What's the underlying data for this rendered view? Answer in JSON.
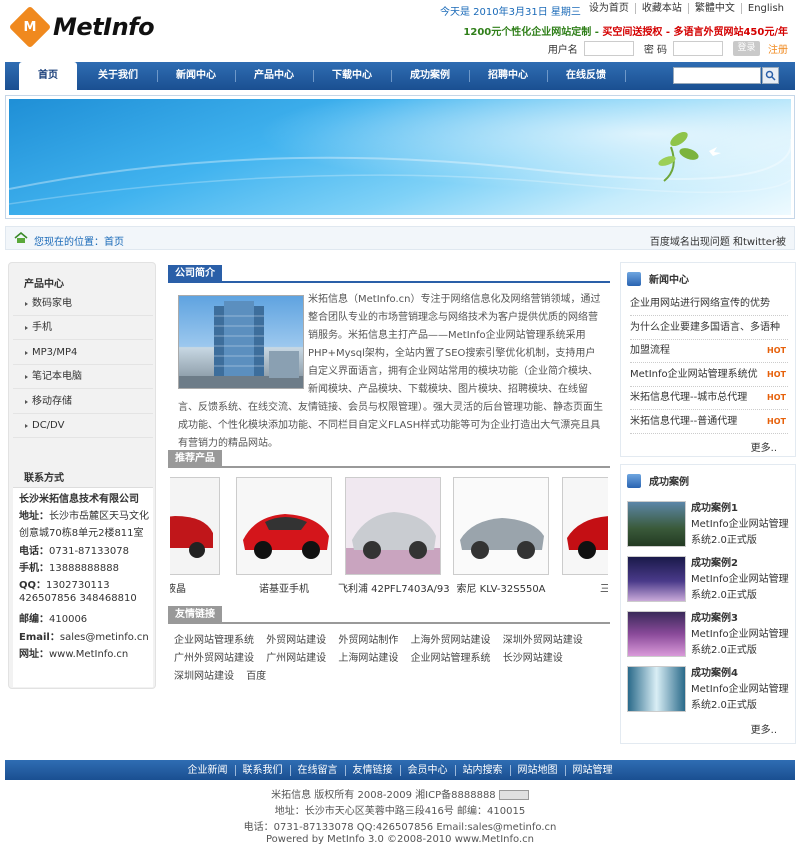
{
  "brand": {
    "logo_letter": "M",
    "logo_text": "MetInfo"
  },
  "header": {
    "date_text": "今天是 2010年3月31日 星期三",
    "top_links": [
      "设为首页",
      "收藏本站",
      "繁體中文",
      "English"
    ],
    "promo_green": "1200元个性化企业网站定制 - ",
    "promo_red": "买空间送授权 - 多语言外贸网站450元/年",
    "username_label": "用户名",
    "password_label": "密 码",
    "login_button": "登录",
    "register_link": "注册"
  },
  "nav": {
    "items": [
      "首页",
      "关于我们",
      "新闻中心",
      "产品中心",
      "下载中心",
      "成功案例",
      "招聘中心",
      "在线反馈"
    ]
  },
  "breadcrumb": {
    "label": "您现在的位置：首页",
    "scroll_news": "百度域名出现问题 和twitter被"
  },
  "left": {
    "product_title": "产品中心",
    "product_items": [
      "数码家电",
      "手机",
      "MP3/MP4",
      "笔记本电脑",
      "移动存储",
      "DC/DV"
    ],
    "contact_title": "联系方式",
    "company": "长沙米拓信息技术有限公司",
    "address_label": "地址：",
    "address": "长沙市岳麓区天马文化",
    "address2": "创意城70栋8单元2楼811室",
    "phone_label": "电话：",
    "phone": "0731-87133078",
    "mobile_label": "手机：",
    "mobile": "13888888888",
    "qq_label": "QQ：",
    "qq": "1302730113",
    "qq2": "426507856 348468810",
    "zip_label": "邮编：",
    "zip": "410006",
    "email_label": "Email：",
    "email": "sales@metinfo.cn",
    "web_label": "网址：",
    "web": "www.MetInfo.cn"
  },
  "center": {
    "intro_title": "公司简介",
    "intro_text": "米拓信息（MetInfo.cn）专注于网络信息化及网络营销领域，通过整合团队专业的市场营销理念与网络技术为客户提供优质的网络营销服务。米拓信息主打产品——MetInfo企业网站管理系统采用PHP+Mysql架构，全站内置了SEO搜索引擎优化机制，支持用户自定义界面语言，拥有企业网站常用的模块功能（企业简介模块、新闻模块、产品模块、下载模块、图片模块、招聘模块、在线留言、反馈系统、在线交流、友情链接、会员与权限管理）。强大灵活的后台管理功能、静态页面生成功能、个性化模块添加功能、不同栏目自定义FLASH样式功能等可为企业打造出大气漂亮且具有营销力的精品网站。",
    "products_title": "推荐产品",
    "products": [
      "屏液晶",
      "诺基亚手机",
      "飞利浦 42PFL7403A/93",
      "索尼 KLV-32S550A",
      "三星"
    ],
    "links_title": "友情链接",
    "links": [
      "企业网站管理系统",
      "外贸网站建设",
      "外贸网站制作",
      "上海外贸网站建设",
      "深圳外贸网站建设",
      "广州外贸网站建设",
      "广州网站建设",
      "上海网站建设",
      "企业网站管理系统",
      "长沙网站建设",
      "深圳网站建设",
      "百度"
    ]
  },
  "right": {
    "news_title": "新闻中心",
    "news": [
      {
        "text": "企业用网站进行网络宣传的优势",
        "hot": ""
      },
      {
        "text": "为什么企业要建多国语言、多语种",
        "hot": ""
      },
      {
        "text": "加盟流程",
        "hot": "HOT"
      },
      {
        "text": "MetInfo企业网站管理系统优",
        "hot": "HOT"
      },
      {
        "text": "米拓信息代理--城市总代理",
        "hot": "HOT"
      },
      {
        "text": "米拓信息代理--普通代理",
        "hot": "HOT"
      }
    ],
    "more": "更多..",
    "cases_title": "成功案例",
    "cases": [
      {
        "title": "成功案例1",
        "desc": "MetInfo企业网站管理系统2.0正式版"
      },
      {
        "title": "成功案例2",
        "desc": "MetInfo企业网站管理系统2.0正式版"
      },
      {
        "title": "成功案例3",
        "desc": "MetInfo企业网站管理系统2.0正式版"
      },
      {
        "title": "成功案例4",
        "desc": "MetInfo企业网站管理系统2.0正式版"
      }
    ]
  },
  "footer": {
    "nav": [
      "企业新闻",
      "联系我们",
      "在线留言",
      "友情链接",
      "会员中心",
      "站内搜索",
      "网站地图",
      "网站管理"
    ],
    "copyright": "米拓信息 版权所有 2008-2009 湘ICP备8888888",
    "address": "地址：长沙市天心区芙蓉中路三段416号 邮编：410015",
    "contact": "电话：0731-87133078 QQ:426507856 Email:sales@metinfo.cn",
    "powered": "Powered by MetInfo 3.0 ©2008-2010 www.MetInfo.cn"
  },
  "colors": {
    "nav_blue": "#2a5fa8",
    "brand_orange": "#f0891e",
    "hot_orange": "#e6600a",
    "promo_red": "#d40000",
    "promo_green": "#2f7f19"
  }
}
